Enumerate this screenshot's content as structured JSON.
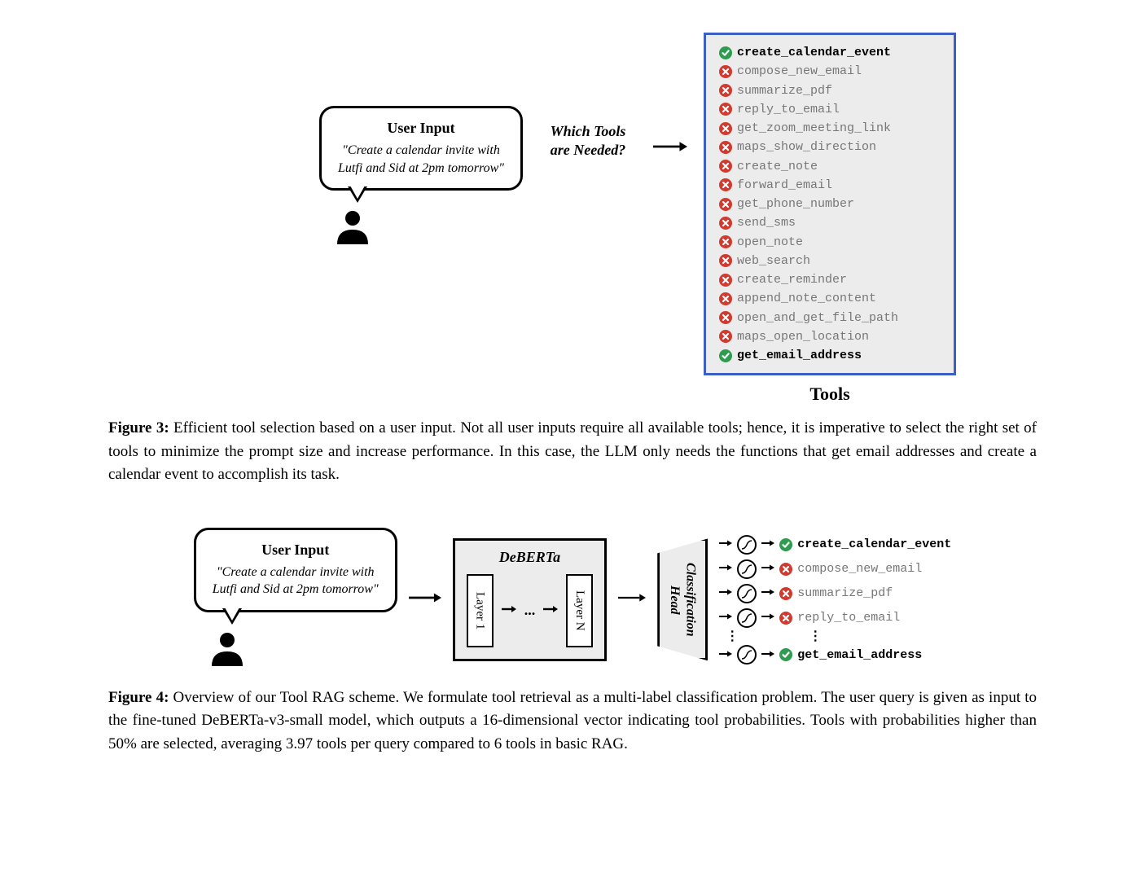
{
  "figure3": {
    "user_input": {
      "title": "User Input",
      "text": "\"Create a calendar invite with Lutfi and Sid at 2pm tomorrow\""
    },
    "question": "Which Tools are Needed?",
    "tools_label": "Tools",
    "tools": [
      {
        "name": "create_calendar_event",
        "selected": true
      },
      {
        "name": "compose_new_email",
        "selected": false
      },
      {
        "name": "summarize_pdf",
        "selected": false
      },
      {
        "name": "reply_to_email",
        "selected": false
      },
      {
        "name": "get_zoom_meeting_link",
        "selected": false
      },
      {
        "name": "maps_show_direction",
        "selected": false
      },
      {
        "name": "create_note",
        "selected": false
      },
      {
        "name": "forward_email",
        "selected": false
      },
      {
        "name": "get_phone_number",
        "selected": false
      },
      {
        "name": "send_sms",
        "selected": false
      },
      {
        "name": "open_note",
        "selected": false
      },
      {
        "name": "web_search",
        "selected": false
      },
      {
        "name": "create_reminder",
        "selected": false
      },
      {
        "name": "append_note_content",
        "selected": false
      },
      {
        "name": "open_and_get_file_path",
        "selected": false
      },
      {
        "name": "maps_open_location",
        "selected": false
      },
      {
        "name": "get_email_address",
        "selected": true
      }
    ],
    "caption_label": "Figure 3:",
    "caption_text": "Efficient tool selection based on a user input. Not all user inputs require all available tools; hence, it is imperative to select the right set of tools to minimize the prompt size and increase performance. In this case, the LLM only needs the functions that get email addresses and create a calendar event to accomplish its task."
  },
  "figure4": {
    "user_input": {
      "title": "User Input",
      "text": "\"Create a calendar invite with Lutfi and Sid at 2pm tomorrow\""
    },
    "deberta_label": "DeBERTa",
    "layer1": "Layer 1",
    "layerN": "Layer N",
    "dots": "...",
    "class_head": "Classification Head",
    "outputs": [
      {
        "name": "create_calendar_event",
        "selected": true
      },
      {
        "name": "compose_new_email",
        "selected": false
      },
      {
        "name": "summarize_pdf",
        "selected": false
      },
      {
        "name": "reply_to_email",
        "selected": false
      },
      {
        "name": "get_email_address",
        "selected": true
      }
    ],
    "caption_label": "Figure 4:",
    "caption_text": "Overview of our Tool RAG scheme. We formulate tool retrieval as a multi-label classification problem. The user query is given as input to the fine-tuned DeBERTa-v3-small model, which outputs a 16-dimensional vector indicating tool probabilities. Tools with probabilities higher than 50% are selected, averaging 3.97 tools per query compared to 6 tools in basic RAG."
  }
}
